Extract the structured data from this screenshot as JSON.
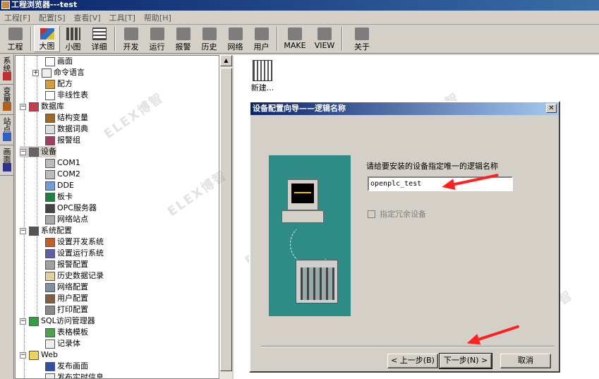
{
  "window": {
    "title": "工程浏览器---test"
  },
  "menu": [
    "工程[F]",
    "配置[S]",
    "查看[V]",
    "工具[T]",
    "帮助[H]"
  ],
  "toolbar": {
    "buttons": [
      "工程",
      "大图",
      "小图",
      "详细",
      "开发",
      "运行",
      "报警",
      "历史",
      "网络",
      "用户",
      "MAKE",
      "VIEW",
      "关于"
    ]
  },
  "side_tabs": [
    "系统",
    "变量",
    "站点",
    "画面"
  ],
  "tree": {
    "items": [
      {
        "label": "画面"
      },
      {
        "label": "命令语言"
      },
      {
        "label": "配方"
      },
      {
        "label": "非线性表"
      },
      {
        "label": "数据库"
      },
      {
        "label": "结构变量"
      },
      {
        "label": "数据词典"
      },
      {
        "label": "报警组"
      },
      {
        "label": "设备"
      },
      {
        "label": "COM1"
      },
      {
        "label": "COM2"
      },
      {
        "label": "DDE"
      },
      {
        "label": "板卡"
      },
      {
        "label": "OPC服务器"
      },
      {
        "label": "网络站点"
      },
      {
        "label": "系统配置"
      },
      {
        "label": "设置开发系统"
      },
      {
        "label": "设置运行系统"
      },
      {
        "label": "报警配置"
      },
      {
        "label": "历史数据记录"
      },
      {
        "label": "网络配置"
      },
      {
        "label": "用户配置"
      },
      {
        "label": "打印配置"
      },
      {
        "label": "SQL访问管理器"
      },
      {
        "label": "表格模板"
      },
      {
        "label": "记录体"
      },
      {
        "label": "Web"
      },
      {
        "label": "发布画面"
      },
      {
        "label": "发布实时信息"
      }
    ]
  },
  "right_pane": {
    "new_item_label": "新建..."
  },
  "dialog": {
    "title": "设备配置向导——逻辑名称",
    "prompt": "请给要安装的设备指定唯一的逻辑名称",
    "logical_name_value": "openplc_test",
    "redundant_label": "指定冗余设备",
    "redundant_checked": false,
    "buttons": {
      "back": "< 上一步(B)",
      "next": "下一步(N) >",
      "cancel": "取消"
    }
  },
  "watermark": "ELEX博智",
  "colors": {
    "title_bar": "#0a246a",
    "wizard_panel": "#2f8b86",
    "annotation_arrow": "#ff2020"
  }
}
